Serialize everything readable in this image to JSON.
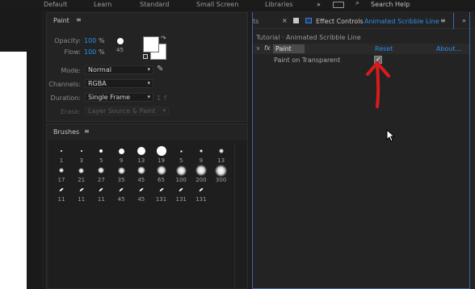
{
  "topbar": {
    "workspaces": [
      "Default",
      "Learn",
      "Standard",
      "Small Screen",
      "Libraries"
    ],
    "more_glyph": "»",
    "search_label": "Search Help"
  },
  "paint": {
    "title": "Paint",
    "opacity_label": "Opacity:",
    "opacity_value": "100",
    "flow_label": "Flow:",
    "flow_value": "100",
    "percent": "%",
    "brush_size": "45",
    "mode_label": "Mode:",
    "mode_value": "Normal",
    "channels_label": "Channels:",
    "channels_value": "RGBA",
    "duration_label": "Duration:",
    "duration_value": "Single Frame",
    "duration_extra": "1",
    "duration_f": "f",
    "erase_label": "Erase:",
    "erase_value": "Layer Source & Paint"
  },
  "brushes": {
    "title": "Brushes",
    "sizes": [
      "1",
      "3",
      "5",
      "9",
      "13",
      "19",
      "5",
      "9",
      "13",
      "17",
      "21",
      "27",
      "35",
      "45",
      "65",
      "100",
      "200",
      "300",
      "11",
      "11",
      "11",
      "45",
      "45",
      "131",
      "131",
      "131"
    ]
  },
  "effects": {
    "left_tab_fragment": "ts",
    "close_glyph": "×",
    "tab_label": "Effect Controls",
    "tab_layer": "Animated Scribble Line",
    "breadcrumb": "Tutorial · Animated Scribble Line",
    "fx_glyph": "fx",
    "effect_name": "Paint",
    "reset_label": "Reset",
    "about_label": "About...",
    "param_label": "Paint on Transparent",
    "param_checked": true
  },
  "annotation": {
    "color": "#d81b1b"
  }
}
